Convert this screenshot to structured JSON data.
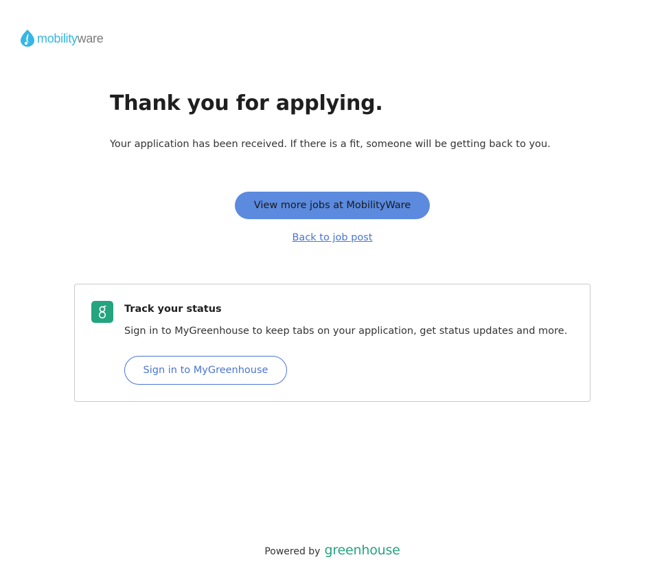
{
  "brand": {
    "logo_text_a": "mobility",
    "logo_text_b": "ware",
    "logo_icon": "mobilityware-logo-icon",
    "accent_color": "#35b7e3"
  },
  "confirmation": {
    "title": "Thank you for applying.",
    "message": "Your application has been received. If there is a fit, someone will be getting back to you."
  },
  "actions": {
    "view_more_jobs_label": "View more jobs at MobilityWare",
    "back_to_job_post_label": "Back to job post",
    "primary_color": "#5b8ade",
    "link_color": "#4a74d4"
  },
  "track_status": {
    "icon": "greenhouse-g-icon",
    "title": "Track your status",
    "description": "Sign in to MyGreenhouse to keep tabs on your application, get status updates and more.",
    "sign_in_label": "Sign in to MyGreenhouse",
    "badge_color": "#24a47f"
  },
  "footer": {
    "powered_by": "Powered by",
    "brand_word": "greenhouse"
  }
}
